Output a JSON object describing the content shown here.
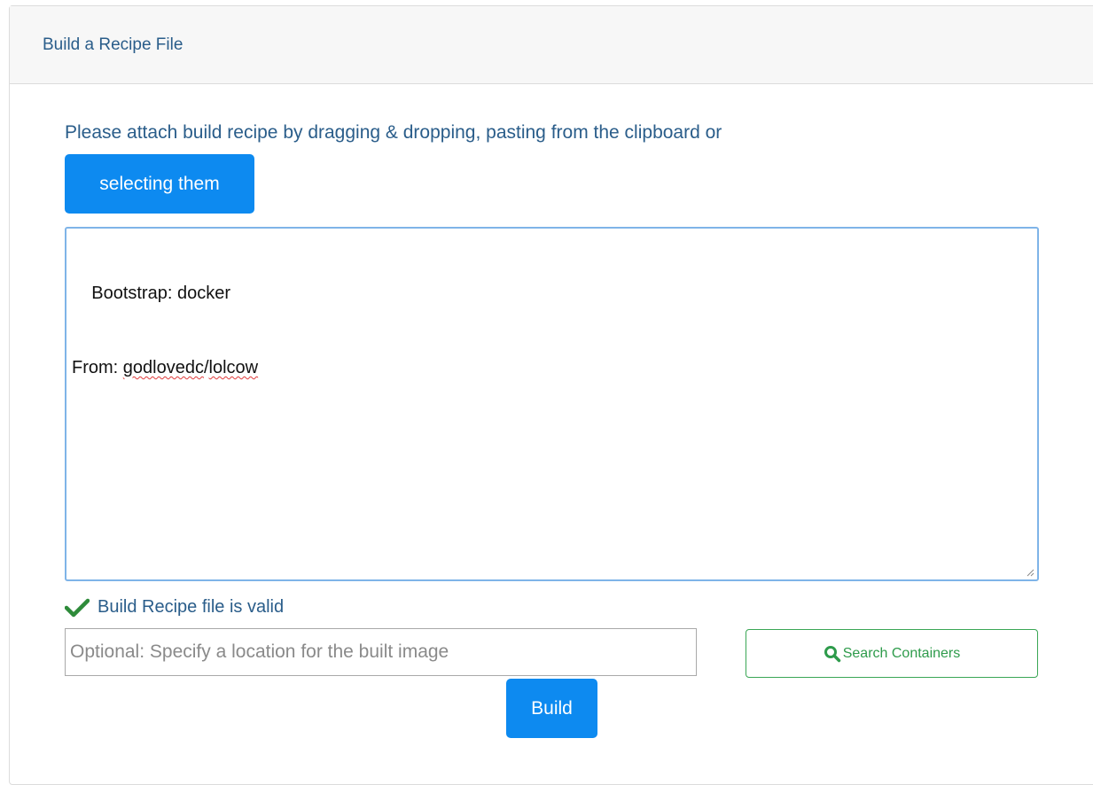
{
  "panel": {
    "title": "Build a Recipe File"
  },
  "instructions": "Please attach build recipe by dragging & dropping, pasting from the clipboard or",
  "select_button": "selecting them",
  "recipe": {
    "lines": [
      {
        "prefix": "Bootstrap: docker",
        "flagged": []
      },
      {
        "prefix": "From: ",
        "flagged": [
          "godlovedc",
          "lolcow"
        ],
        "separator": "/"
      }
    ]
  },
  "validation": {
    "message": "Build Recipe file is valid",
    "icon": "check-icon",
    "color": "#2e8b3a"
  },
  "location_input": {
    "value": "",
    "placeholder": "Optional: Specify a location for the built image"
  },
  "search_button": {
    "label": "Search Containers",
    "icon": "search-icon"
  },
  "build_button": {
    "label": "Build"
  },
  "colors": {
    "primary": "#0d8af0",
    "header_text": "#2a5d8a",
    "success": "#2e9b4b"
  }
}
